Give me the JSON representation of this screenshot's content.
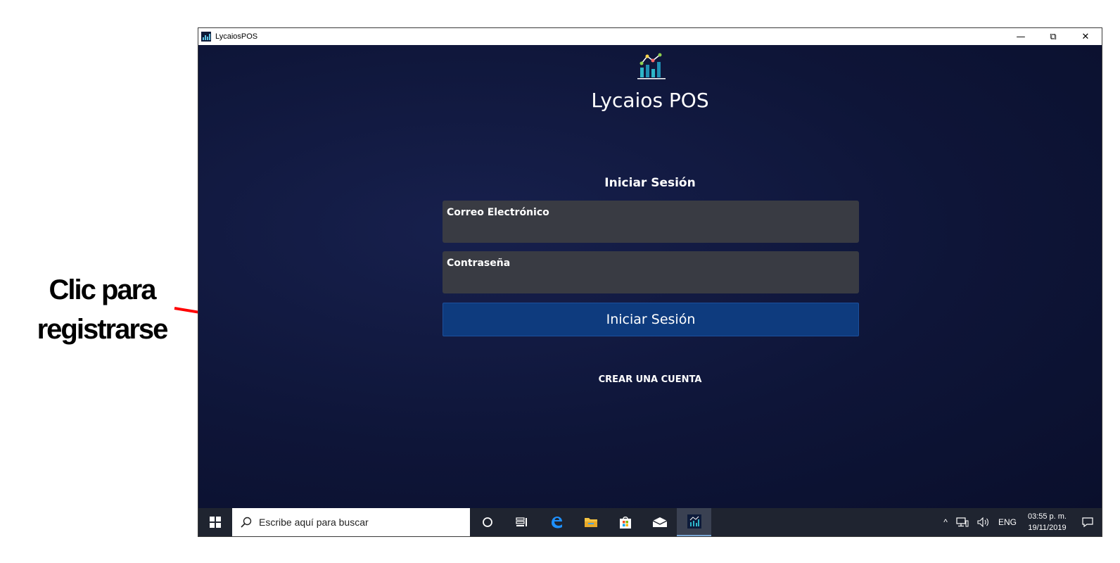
{
  "annotation": {
    "line1": "Clic para",
    "line2": "registrarse",
    "arrow_color": "#ff0000"
  },
  "window": {
    "title": "LycaiosPOS",
    "minimize_glyph": "—",
    "maximize_glyph": "⧉",
    "close_glyph": "✕"
  },
  "app": {
    "name": "Lycaios POS",
    "login_heading": "Iniciar Sesión",
    "email_label": "Correo Electrónico",
    "email_value": "",
    "password_label": "Contraseña",
    "password_value": "",
    "login_button": "Iniciar Sesión",
    "create_account": "CREAR UNA CUENTA",
    "colors": {
      "background": "#0e1538",
      "field": "#393b43",
      "button": "#0e3b7e",
      "logo_teal": "#2db6c9",
      "logo_points": [
        "#8fd14f",
        "#ffd54a",
        "#ff6b6b"
      ]
    }
  },
  "taskbar": {
    "search_placeholder": "Escribe aquí para buscar",
    "icons": [
      "windows-start-icon",
      "search-icon",
      "cortana-icon",
      "task-view-icon",
      "edge-icon",
      "file-explorer-icon",
      "store-icon",
      "mail-icon",
      "lycaios-pos-icon"
    ],
    "tray": {
      "chevron": "^",
      "language": "ENG",
      "time": "03:55 p. m.",
      "date": "19/11/2019"
    }
  }
}
